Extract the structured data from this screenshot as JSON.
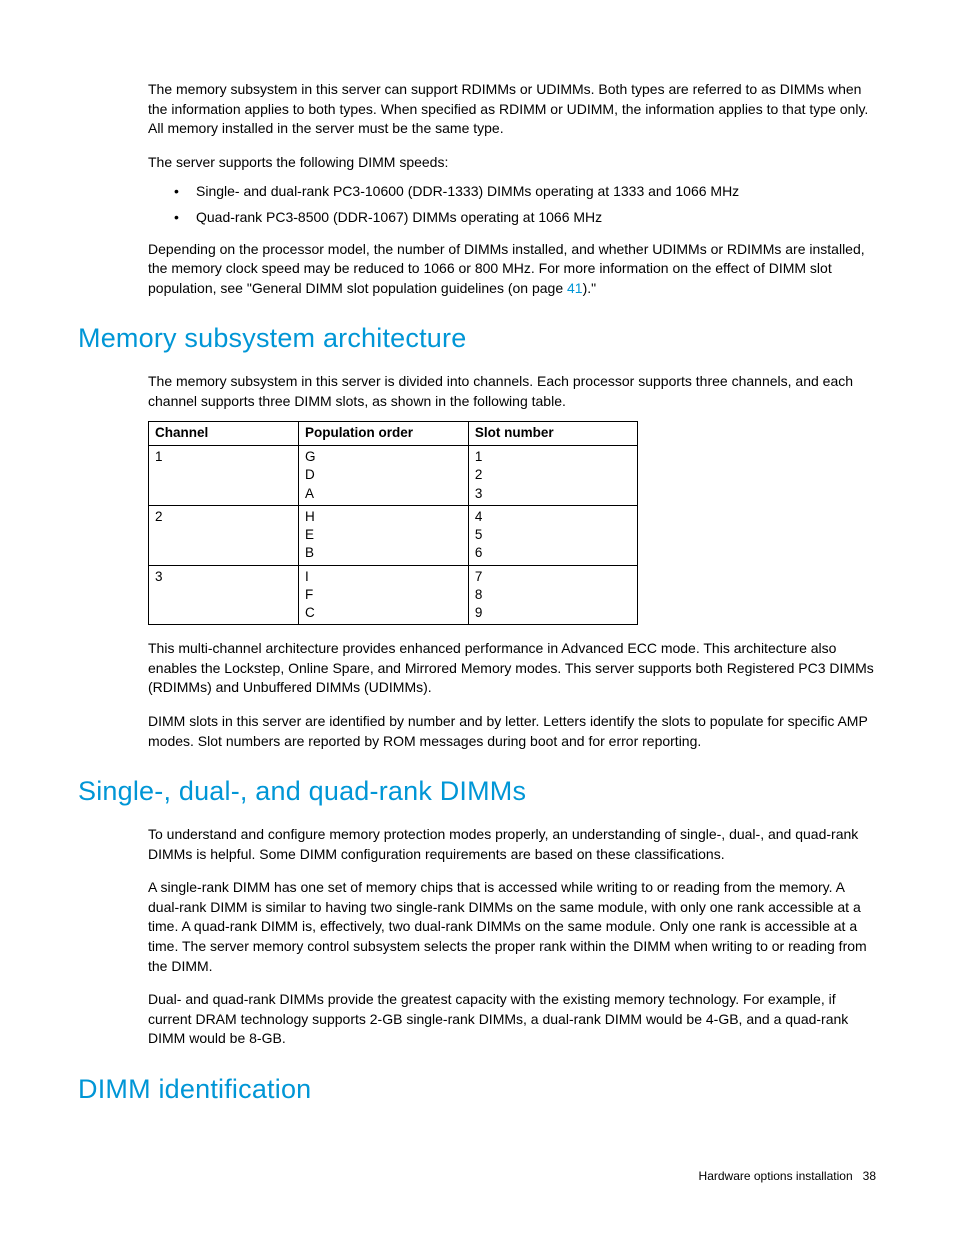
{
  "intro": {
    "p1": "The memory subsystem in this server can support RDIMMs or UDIMMs. Both types are referred to as DIMMs when the information applies to both types. When specified as RDIMM or UDIMM, the information applies to that type only. All memory installed in the server must be the same type.",
    "p2": "The server supports the following DIMM speeds:",
    "bullets": [
      "Single- and dual-rank PC3-10600 (DDR-1333) DIMMs operating at 1333 and 1066 MHz",
      "Quad-rank PC3-8500 (DDR-1067) DIMMs operating at 1066 MHz"
    ],
    "p3_pre": "Depending on the processor model, the number of DIMMs installed, and whether UDIMMs or RDIMMs are installed, the memory clock speed may be reduced to 1066 or 800 MHz. For more information on the effect of DIMM slot population, see \"General DIMM slot population guidelines (on page ",
    "p3_link": "41",
    "p3_post": ").\""
  },
  "section1": {
    "title": "Memory subsystem architecture",
    "p1": "The memory subsystem in this server is divided into channels. Each processor supports three channels, and each channel supports three DIMM slots, as shown in the following table.",
    "table": {
      "headers": [
        "Channel",
        "Population order",
        "Slot number"
      ],
      "rows": [
        {
          "channel": "1",
          "order": "G\nD\nA",
          "slot": "1\n2\n3"
        },
        {
          "channel": "2",
          "order": "H\nE\nB",
          "slot": "4\n5\n6"
        },
        {
          "channel": "3",
          "order": "I\nF\nC",
          "slot": "7\n8\n9"
        }
      ]
    },
    "p2": "This multi-channel architecture provides enhanced performance in Advanced ECC mode. This architecture also enables the Lockstep, Online Spare, and Mirrored Memory modes. This server supports both Registered PC3 DIMMs (RDIMMs) and Unbuffered DIMMs (UDIMMs).",
    "p3": "DIMM slots in this server are identified by number and by letter. Letters identify the slots to populate for specific AMP modes. Slot numbers are reported by ROM messages during boot and for error reporting."
  },
  "section2": {
    "title": "Single-, dual-, and quad-rank DIMMs",
    "p1": "To understand and configure memory protection modes properly, an understanding of single-, dual-, and quad-rank DIMMs is helpful. Some DIMM configuration requirements are based on these classifications.",
    "p2": "A single-rank DIMM has one set of memory chips that is accessed while writing to or reading from the memory. A dual-rank DIMM is similar to having two single-rank DIMMs on the same module, with only one rank accessible at a time. A quad-rank DIMM is, effectively, two dual-rank DIMMs on the same module. Only one rank is accessible at a time. The server memory control subsystem selects the proper rank within the DIMM when writing to or reading from the DIMM.",
    "p3": "Dual- and quad-rank DIMMs provide the greatest capacity with the existing memory technology. For example, if current DRAM technology supports 2-GB single-rank DIMMs, a dual-rank DIMM would be 4-GB, and a quad-rank DIMM would be 8-GB."
  },
  "section3": {
    "title": "DIMM identification"
  },
  "footer": {
    "section": "Hardware options installation",
    "page": "38"
  }
}
